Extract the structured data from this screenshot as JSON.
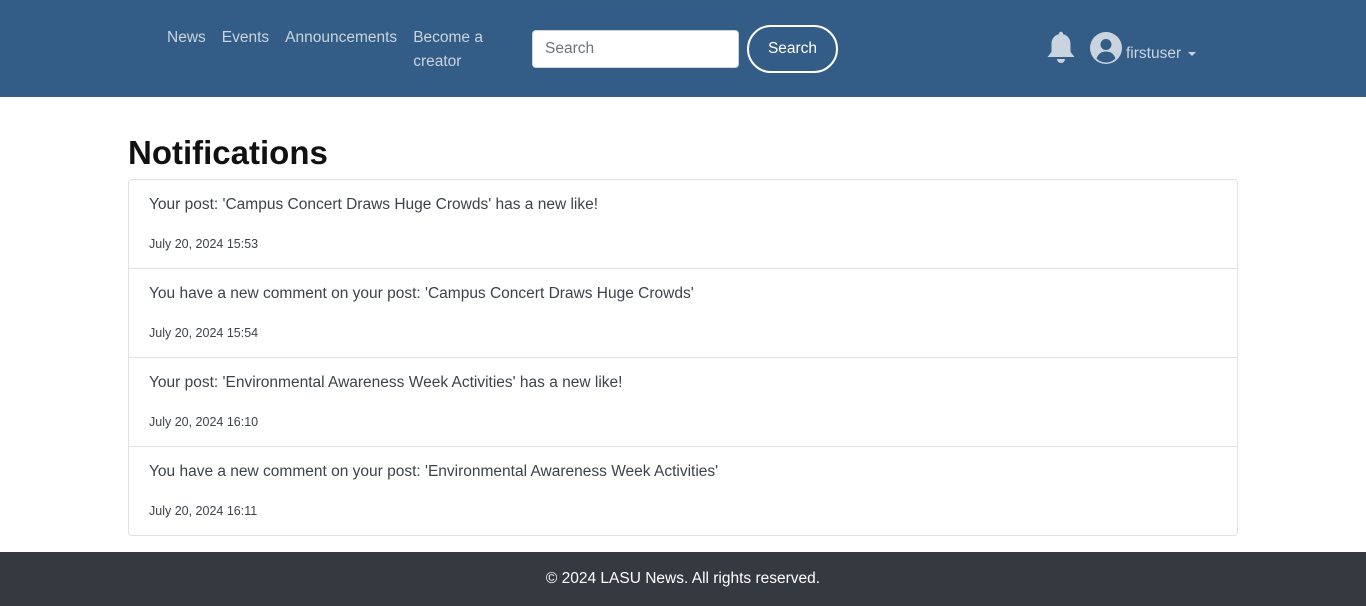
{
  "nav": {
    "links": [
      "News",
      "Events",
      "Announcements",
      "Become a creator"
    ],
    "search_placeholder": "Search",
    "search_value": "",
    "search_button": "Search",
    "username": "firstuser"
  },
  "page": {
    "title": "Notifications"
  },
  "notifications": [
    {
      "message": "Your post: 'Campus Concert Draws Huge Crowds' has a new like!",
      "time": "July 20, 2024 15:53"
    },
    {
      "message": "You have a new comment on your post: 'Campus Concert Draws Huge Crowds'",
      "time": "July 20, 2024 15:54"
    },
    {
      "message": "Your post: 'Environmental Awareness Week Activities' has a new like!",
      "time": "July 20, 2024 16:10"
    },
    {
      "message": "You have a new comment on your post: 'Environmental Awareness Week Activities'",
      "time": "July 20, 2024 16:11"
    }
  ],
  "footer": {
    "text": "© 2024 LASU News. All rights reserved."
  },
  "icons": {
    "bell": "bell-icon",
    "avatar": "user-circle-icon",
    "caret": "caret-down-icon"
  },
  "colors": {
    "navbar": "#335d87",
    "footer": "#343a40",
    "nav_text": "#c9d4df"
  }
}
